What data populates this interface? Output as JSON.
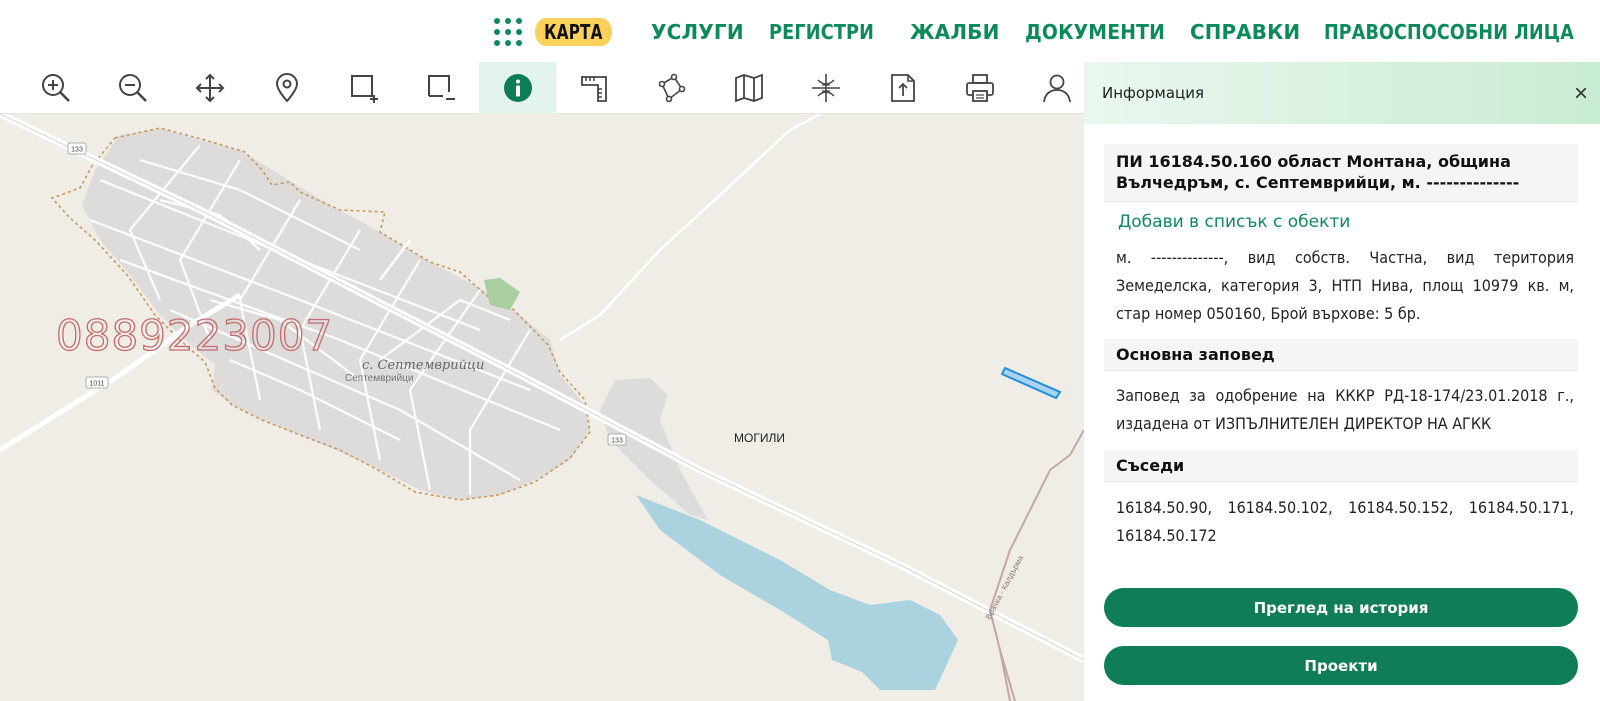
{
  "nav": {
    "items": [
      "КАРТА",
      "УСЛУГИ",
      "РЕГИСТРИ",
      "ЖАЛБИ",
      "ДОКУМЕНТИ",
      "СПРАВКИ",
      "ПРАВОСПОСОБНИ ЛИЦА"
    ],
    "active_index": 0
  },
  "toolbar": {
    "tools": [
      "zoom-in-icon",
      "zoom-out-icon",
      "pan-icon",
      "location-pin-icon",
      "select-add-icon",
      "select-remove-icon",
      "info-icon",
      "measure-icon",
      "polygon-icon",
      "map-layers-icon",
      "crosshair-icon",
      "export-icon",
      "print-icon",
      "user-icon"
    ],
    "active_tool": "info-icon"
  },
  "map": {
    "village_label": "с. Септемврийци",
    "village_sublabel": "Септемврийци",
    "place_label": "МОГИЛИ",
    "road_labels": [
      "133",
      "133",
      "1011"
    ],
    "watermark": "0889223007",
    "small_label": "Врачка - Калдърма"
  },
  "panel": {
    "title": "Информация",
    "close_label": "×",
    "heading": "ПИ 16184.50.160 област Монтана, община Вълчедръм, с. Септемврийци, м. --------------",
    "add_link": "Добави в списък с обекти",
    "description": "м. --------------, вид собств. Частна, вид територия Земеделска, категория 3, НТП Нива, площ 10979 кв. м, стар номер 050160, Брой върхове: 5 бр.",
    "order_title": "Основна заповед",
    "order_text": "Заповед за одобрение на КККР РД-18-174/23.01.2018 г., издадена от ИЗПЪЛНИТЕЛЕН ДИРЕКТОР НА АГКК",
    "neighbors_title": "Съседи",
    "neighbors_text": "16184.50.90, 16184.50.102, 16184.50.152, 16184.50.171, 16184.50.172",
    "history_button": "Преглед на история",
    "projects_button": "Проекти"
  },
  "colors": {
    "brand_green": "#0f7d55",
    "nav_active_bg": "#fcd15a",
    "map_bg": "#efede6",
    "water": "#aad3df"
  }
}
